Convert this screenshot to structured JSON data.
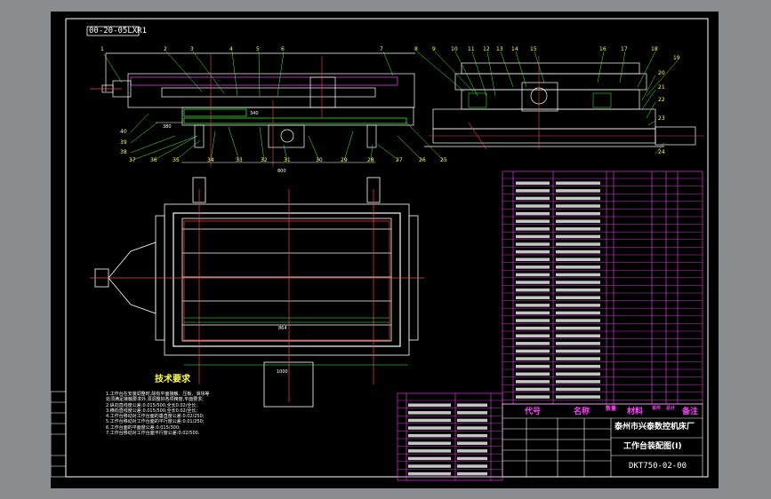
{
  "drawing_code_box": "00-20-05LXR1",
  "parts_table_header": {
    "seq": "序",
    "code": "代号",
    "name": "名称",
    "qty": "数量",
    "material": "材料",
    "unit_weight": "单件",
    "total_weight": "总计",
    "remark": "备注"
  },
  "title_block": {
    "company": "泰州市兴泰数控机床厂",
    "drawing_title": "工作台装配图(I)",
    "drawing_number": "DKT750-02-00"
  },
  "technical_requirements": {
    "heading": "技术要求",
    "items": [
      "1.工作台在安装调整时,除有平面接触、压板、滑块等",
      "  处须满足接触要求外,须调整好各项精度,平面要求;",
      "2.纵向直线度公差:0.015/500,全长0.02/全长;",
      "3.横向直线度公差:0.015/500,全长0.02/全长;",
      "4.工作台移动对工作台面的垂直度公差:0.02/250;",
      "5.工作台移动对工作台面的平行度公差:0.01/250;",
      "6.工作台面的平面度公差:0.015/300;",
      "7.工作台移动对工作台面平行度公差:0.02/500."
    ]
  },
  "front_view": {
    "top_balloons": [
      "1",
      "2",
      "3",
      "4",
      "5",
      "6",
      "7"
    ],
    "left_balloons": [
      "40",
      "39",
      "38"
    ],
    "bottom_balloons": [
      "37",
      "36",
      "35",
      "34",
      "33",
      "32",
      "31",
      "30",
      "29",
      "28",
      "27",
      "26",
      "25"
    ],
    "dims": [
      "380",
      "340",
      "800"
    ]
  },
  "side_view": {
    "top_balloons": [
      "8",
      "9",
      "10",
      "11",
      "12",
      "13",
      "14",
      "15",
      "16",
      "17",
      "18",
      "19"
    ],
    "right_balloons": [
      "20",
      "21",
      "22",
      "23",
      "24"
    ]
  },
  "plan_view": {
    "dims": [
      "864",
      "1000"
    ]
  }
}
